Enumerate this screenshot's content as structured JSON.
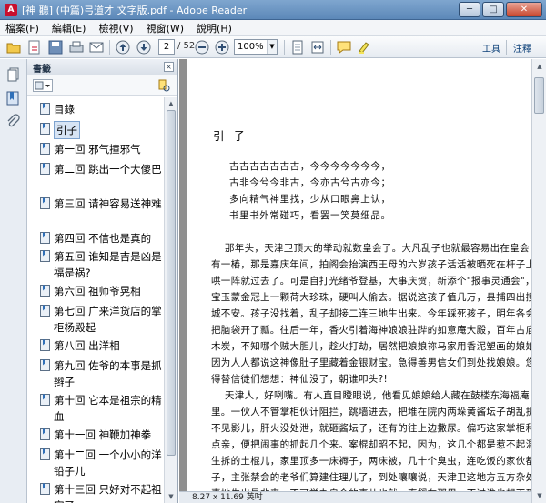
{
  "window": {
    "title": "[神 聽] (中篇)弓道才 文字版.pdf - Adobe Reader",
    "minimize": "─",
    "maximize": "□",
    "close": "✕"
  },
  "menu": [
    "檔案(F)",
    "編輯(E)",
    "檢視(V)",
    "視窗(W)",
    "說明(H)"
  ],
  "toolbar": {
    "page_current": "2",
    "page_total": "/ 52",
    "zoom": "100%",
    "tools_label": "工具",
    "comment_label": "注釋"
  },
  "bookmarks": {
    "title": "書籤",
    "close": "×",
    "items": [
      {
        "label": "目錄"
      },
      {
        "label": "引子"
      },
      {
        "label": "第一回 邪气撞邪气"
      },
      {
        "label": "第二回 跳出一个大傻巴"
      },
      {
        "label": "第三回 请神容易送神难"
      },
      {
        "label": "第四回 不信也是真的"
      },
      {
        "label": "第五回 谁知是吉是凶是福是祸?"
      },
      {
        "label": "第六回 祖师爷晃相"
      },
      {
        "label": "第七回 广来洋货店的掌柜杨殿起"
      },
      {
        "label": "第八回 出洋相"
      },
      {
        "label": "第九回 佐爷的本事是抓辫子"
      },
      {
        "label": "第十回 它本是祖宗的精血"
      },
      {
        "label": "第十一回 神鞭加神拳"
      },
      {
        "label": "第十二回 一个小小的洋铅子儿"
      },
      {
        "label": "第十三回 只好对不起祖宗了"
      }
    ]
  },
  "document": {
    "heading": "引 子",
    "verse": [
      "古古古古古古古，今今今今今今今，",
      "古非今兮今非古，今亦古兮古亦今；",
      "多向精气神里找，少从口眼鼻上认，",
      "书里书外常碰巧，看罢一笑莫细品。"
    ],
    "paragraphs": [
      "那年头，天津卫顶大的举动就数皇会了。大凡乱子也就最容易出在皇会",
      "有一樁，那是嘉庆年间，拍阁会抬演西王母的六岁孩子活活被晒死在杆子上。",
      "哄一阵就过去了。可是自打光绪爷登基，大事庆贺，新添个\"报事灵通会\"，",
      "宝玉蒙金冠上一颗荷大珍珠，硬叫人偷去。据说这孩子值几万，县捕四出搜",
      "城不安。孩子没找着，乱子却接二连三地生出来。今年踩死孩子，明年各会间",
      "把脑袋开了瓢。往后一年，香火引着海神娘娘驻跸的如意庵大殿，百年古庙",
      "木炭，不知哪个贼大胆儿，趁火打劫，居然把娘娘祢马家用香泥塑画的娘娘",
      "因为人人都说这神像肚子里藏着金银财宝。急得善男信女们到处找娘娘。您",
      "得替信徒们想想：神仙没了，朝谁叩头?!",
      "天津人，好咧嘴。有人直目瞪眼说，他看见娘娘给人藏在鼓楼东海福庵",
      "里。一伙人不管掌柜伙计阻拦，跳墙进去，把堆在院内两垛黄酱坛子胡乱折",
      "不见影儿，肝火没处泄，就砸酱坛子，还有的往上边撒尿。偏巧这家掌柜和",
      "点亲，便把闹事的抓起几个来。案棍却昭不起，因为，这几个都是惹不起混",
      "生拆的土棍儿，家里顶多一床褥子，两床被，几十个臭虫，连吃饭的家伙都",
      "子，主张禁会的老爷们算建住理儿了，到处嚷嚷说，天津卫这地方五方杂处，",
      "惠地生出是非来…不可举办皇会的事儿也就一直搁在那里，不过谁也想不到"
    ],
    "page_size": "8.27 x 11.69 英吋"
  }
}
